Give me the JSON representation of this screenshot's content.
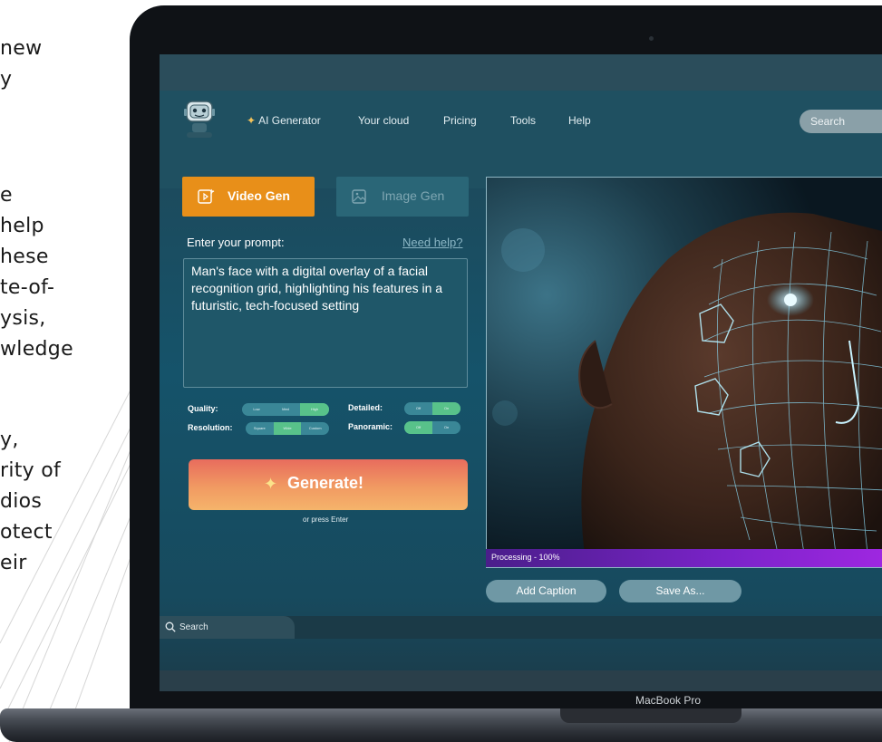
{
  "article": {
    "lines": [
      "new",
      "y",
      "e",
      "help",
      "hese",
      "te-of-",
      "ysis,",
      "wledge",
      "y,",
      "rity of",
      "dios",
      "otect",
      "eir"
    ]
  },
  "laptop": {
    "model": "MacBook Pro"
  },
  "app": {
    "nav": {
      "items": [
        "AI Generator",
        "Your cloud",
        "Pricing",
        "Tools",
        "Help"
      ],
      "search_placeholder": "Search"
    },
    "tabs": {
      "video": "Video Gen",
      "image": "Image Gen"
    },
    "prompt": {
      "label": "Enter your prompt:",
      "help_link": "Need help?",
      "value": "Man's face with a digital overlay of a facial recognition grid, highlighting his features in a futuristic, tech-focused setting"
    },
    "options": {
      "quality": {
        "label": "Quality:",
        "choices": [
          "Low",
          "Med",
          "High"
        ],
        "selected": "High"
      },
      "detailed": {
        "label": "Detailed:",
        "choices": [
          "Off",
          "On"
        ],
        "selected": "On"
      },
      "resolution": {
        "label": "Resolution:",
        "choices": [
          "Square",
          "Wide",
          "Custom"
        ],
        "selected": "Wide"
      },
      "panoramic": {
        "label": "Panoramic:",
        "choices": [
          "Off",
          "On"
        ],
        "selected": "Off"
      }
    },
    "generate": {
      "label": "Generate!",
      "hint": "or press Enter"
    },
    "preview": {
      "status": "Processing - 100%",
      "progress": 1.0
    },
    "actions": {
      "caption": "Add Caption",
      "save": "Save As..."
    },
    "bottom_search": "Search",
    "colors": {
      "accent_orange": "#e88f19",
      "progress_purple": "#9e27e0",
      "toggle_green": "#58c28a"
    }
  }
}
